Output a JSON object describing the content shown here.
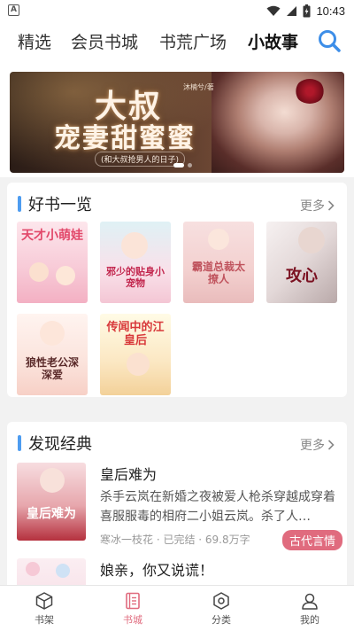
{
  "status_bar": {
    "time": "10:43",
    "app_badge": "A"
  },
  "top_tabs": [
    "精选",
    "会员书城",
    "书荒广场",
    "小故事"
  ],
  "active_tab": 3,
  "banner": {
    "title_line1": "大叔",
    "title_line2": "宠妻甜蜜蜜",
    "author": "沐楠兮/著",
    "subtitle": "(和大叔抢男人的日子)"
  },
  "good_books": {
    "title": "好书一览",
    "more": "更多",
    "covers": [
      {
        "text": "天才小萌娃"
      },
      {
        "text": "邪少的贴身小宠物"
      },
      {
        "text": "霸道总裁太撩人"
      },
      {
        "text": "攻心"
      },
      {
        "text": "狼性老公深深爱"
      },
      {
        "text": "传闻中的江皇后"
      }
    ]
  },
  "discover": {
    "title": "发现经典",
    "more": "更多",
    "books": [
      {
        "title": "皇后难为",
        "desc": "杀手云岚在新婚之夜被爱人枪杀穿越成穿着喜服服毒的相府二小姐云岚。杀了人…",
        "meta": "寒冰一枝花 · 已完结 · 69.8万字",
        "tag": "古代言情",
        "cover_text": "皇后难为"
      },
      {
        "title": "娘亲，你又说谎！",
        "desc": "",
        "meta": "",
        "tag": "",
        "cover_text": ""
      }
    ]
  },
  "bottom_nav": [
    {
      "label": "书架",
      "icon": "box-icon"
    },
    {
      "label": "书城",
      "icon": "book-icon"
    },
    {
      "label": "分类",
      "icon": "hexagon-icon"
    },
    {
      "label": "我的",
      "icon": "person-icon"
    }
  ],
  "colors": {
    "accent": "#e06b7e",
    "section_bar": "#4d9cf0",
    "search": "#3d8ee8"
  }
}
